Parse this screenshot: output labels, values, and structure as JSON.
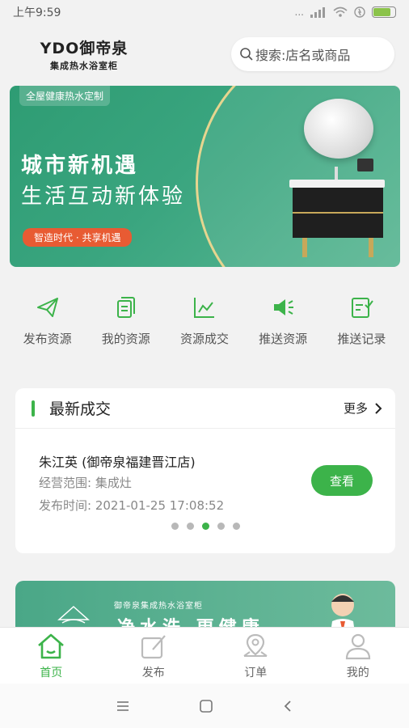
{
  "status_bar": {
    "time": "上午9:59",
    "signal_text": "...",
    "battery_level": 0.8
  },
  "header": {
    "logo_top": "YDO御帝泉",
    "logo_sub": "集成热水浴室柜",
    "search_placeholder": "搜索:店名或商品"
  },
  "banner": {
    "tag": "全屋健康热水定制",
    "title1": "城市新机遇",
    "title2": "生活互动新体验",
    "pill": "智造时代 · 共享机遇"
  },
  "quick_actions": [
    {
      "label": "发布资源",
      "icon": "send-icon"
    },
    {
      "label": "我的资源",
      "icon": "document-icon"
    },
    {
      "label": "资源成交",
      "icon": "chart-icon"
    },
    {
      "label": "推送资源",
      "icon": "megaphone-icon"
    },
    {
      "label": "推送记录",
      "icon": "edit-record-icon"
    }
  ],
  "latest_deals": {
    "title": "最新成交",
    "more": "更多",
    "name": "朱江英 (御帝泉福建晋江店)",
    "scope": "经营范围: 集成灶",
    "time": "发布时间: 2021-01-25 17:08:52",
    "view_button": "查看",
    "page_count": 5,
    "active_page": 3
  },
  "promo": {
    "small_text": "御帝泉集成热水浴室柜",
    "big_text": "净水洗 更健康"
  },
  "tabbar": [
    {
      "label": "首页",
      "icon": "home-icon",
      "active": true
    },
    {
      "label": "发布",
      "icon": "publish-icon",
      "active": false
    },
    {
      "label": "订单",
      "icon": "location-icon",
      "active": false
    },
    {
      "label": "我的",
      "icon": "user-icon",
      "active": false
    }
  ],
  "colors": {
    "accent": "#3cb34a",
    "banner": "#2e9c73",
    "pill": "#e85b33"
  }
}
